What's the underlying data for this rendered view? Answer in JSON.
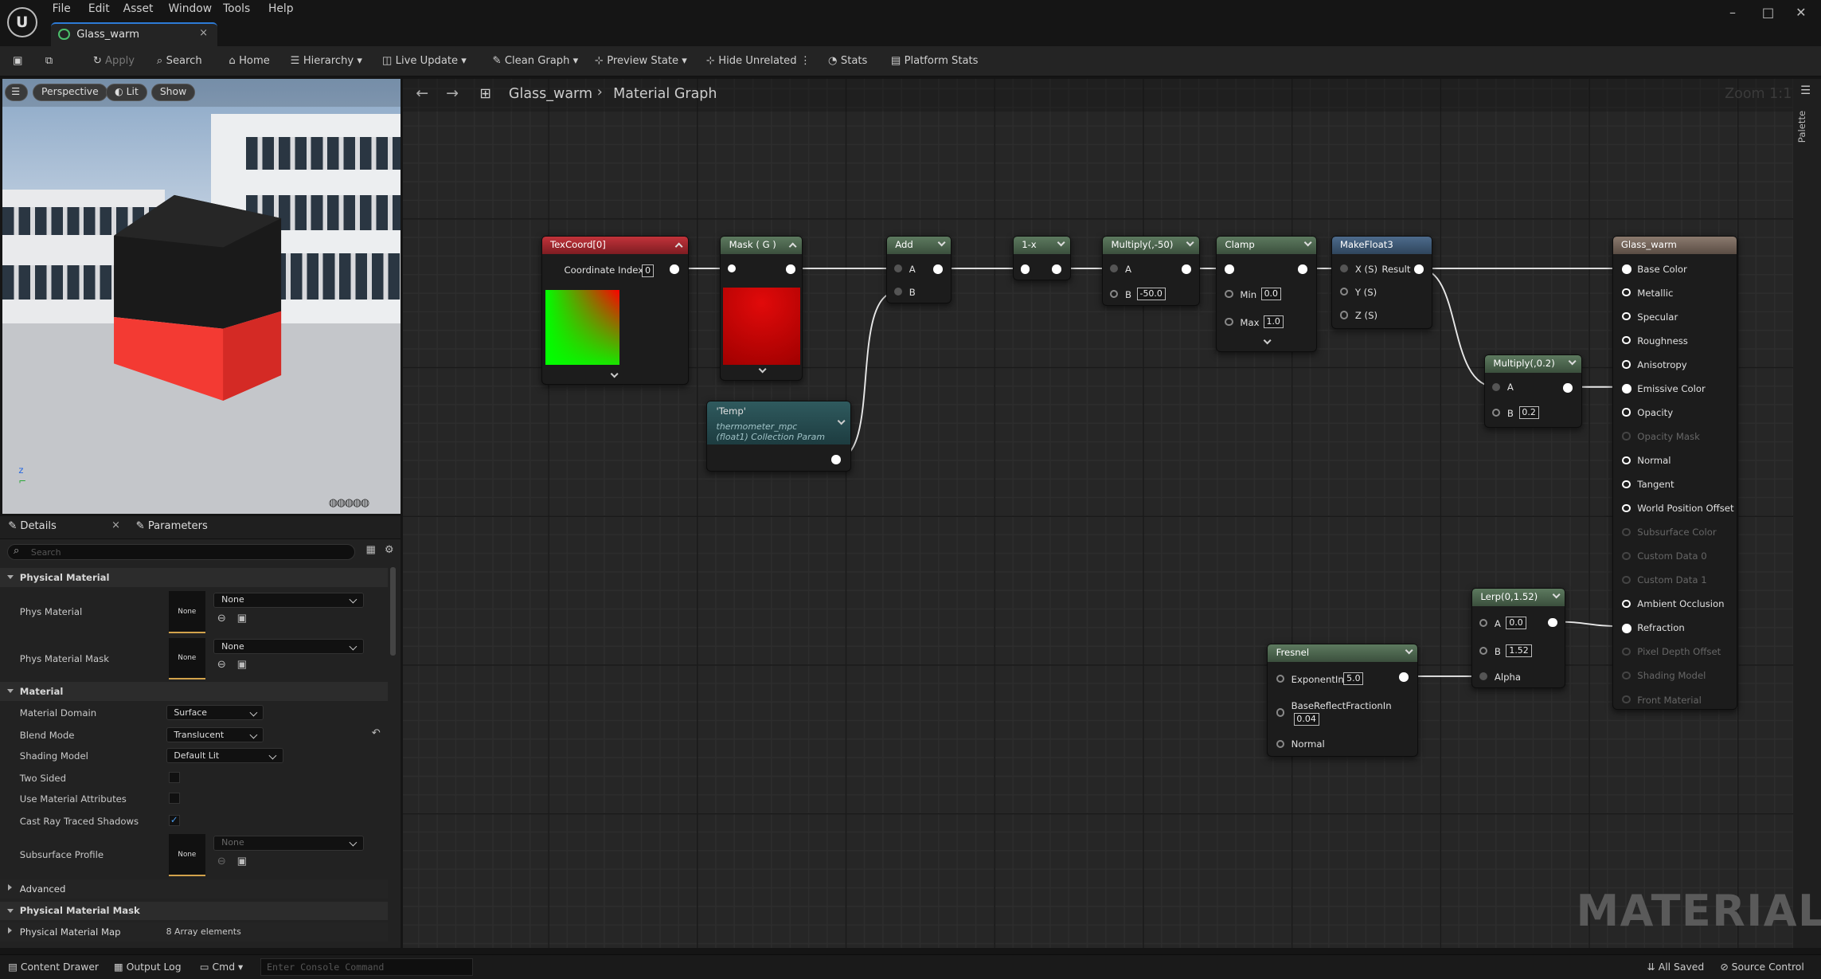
{
  "menu": [
    "File",
    "Edit",
    "Asset",
    "Window",
    "Tools",
    "Help"
  ],
  "tab": {
    "title": "Glass_warm",
    "close": "×"
  },
  "window_controls": {
    "minimize": "–",
    "maximize": "□",
    "close": "✕"
  },
  "toolbar": {
    "apply": "Apply",
    "search": "Search",
    "home": "Home",
    "hierarchy": "Hierarchy",
    "live_update": "Live Update",
    "clean_graph": "Clean Graph",
    "preview_state": "Preview State",
    "hide_unrelated": "Hide Unrelated",
    "stats": "Stats",
    "platform_stats": "Platform Stats"
  },
  "viewport": {
    "perspective": "Perspective",
    "lit": "Lit",
    "show": "Show"
  },
  "panels": {
    "details": "Details",
    "parameters": "Parameters",
    "search_placeholder": "Search"
  },
  "details": {
    "sections": {
      "physical_material": "Physical Material",
      "material": "Material",
      "advanced": "Advanced",
      "physical_material_mask": "Physical Material Mask"
    },
    "phys_material": {
      "label": "Phys Material",
      "thumb": "None",
      "value": "None"
    },
    "phys_material_mask": {
      "label": "Phys Material Mask",
      "thumb": "None",
      "value": "None"
    },
    "material_domain": {
      "label": "Material Domain",
      "value": "Surface"
    },
    "blend_mode": {
      "label": "Blend Mode",
      "value": "Translucent"
    },
    "shading_model": {
      "label": "Shading Model",
      "value": "Default Lit"
    },
    "two_sided": {
      "label": "Two Sided",
      "checked": false
    },
    "use_material_attributes": {
      "label": "Use Material Attributes",
      "checked": false
    },
    "cast_ray_traced_shadows": {
      "label": "Cast Ray Traced Shadows",
      "checked": true
    },
    "subsurface_profile": {
      "label": "Subsurface Profile",
      "thumb": "None",
      "value": "None"
    },
    "physical_material_map": {
      "label": "Physical Material Map",
      "value": "8 Array elements"
    }
  },
  "graph": {
    "breadcrumb_root": "Glass_warm",
    "breadcrumb_leaf": "Material Graph",
    "zoom": "Zoom 1:1",
    "palette": "Palette",
    "watermark": "MATERIAL"
  },
  "nodes": {
    "texcoord": {
      "title": "TexCoord[0]",
      "pin_label": "Coordinate Index",
      "value": "0"
    },
    "mask": {
      "title": "Mask ( G )"
    },
    "add": {
      "title": "Add",
      "a": "A",
      "b": "B"
    },
    "oneminus": {
      "title": "1-x"
    },
    "multiply50": {
      "title": "Multiply(,-50)",
      "a": "A",
      "b": "B",
      "b_value": "-50.0"
    },
    "clamp": {
      "title": "Clamp",
      "min": "Min",
      "min_value": "0.0",
      "max": "Max",
      "max_value": "1.0"
    },
    "makefloat3": {
      "title": "MakeFloat3",
      "x": "X (S)",
      "y": "Y (S)",
      "z": "Z (S)",
      "result": "Result"
    },
    "multiply02": {
      "title": "Multiply(,0.2)",
      "a": "A",
      "b": "B",
      "b_value": "0.2"
    },
    "temp": {
      "title": "'Temp'",
      "sub1": "thermometer_mpc",
      "sub2": "(float1) Collection Param"
    },
    "lerp": {
      "title": "Lerp(0,1.52)",
      "a": "A",
      "a_value": "0.0",
      "b": "B",
      "b_value": "1.52",
      "alpha": "Alpha"
    },
    "fresnel": {
      "title": "Fresnel",
      "exponent": "ExponentIn",
      "exponent_value": "5.0",
      "base": "BaseReflectFractionIn",
      "base_value": "0.04",
      "normal": "Normal"
    },
    "result": {
      "title": "Glass_warm",
      "pins": [
        "Base Color",
        "Metallic",
        "Specular",
        "Roughness",
        "Anisotropy",
        "Emissive Color",
        "Opacity",
        "Opacity Mask",
        "Normal",
        "Tangent",
        "World Position Offset",
        "Subsurface Color",
        "Custom Data 0",
        "Custom Data 1",
        "Ambient Occlusion",
        "Refraction",
        "Pixel Depth Offset",
        "Shading Model",
        "Front Material"
      ]
    }
  },
  "statusbar": {
    "content_drawer": "Content Drawer",
    "output_log": "Output Log",
    "cmd": "Cmd",
    "console_placeholder": "Enter Console Command",
    "all_saved": "All Saved",
    "source_control": "Source Control"
  }
}
